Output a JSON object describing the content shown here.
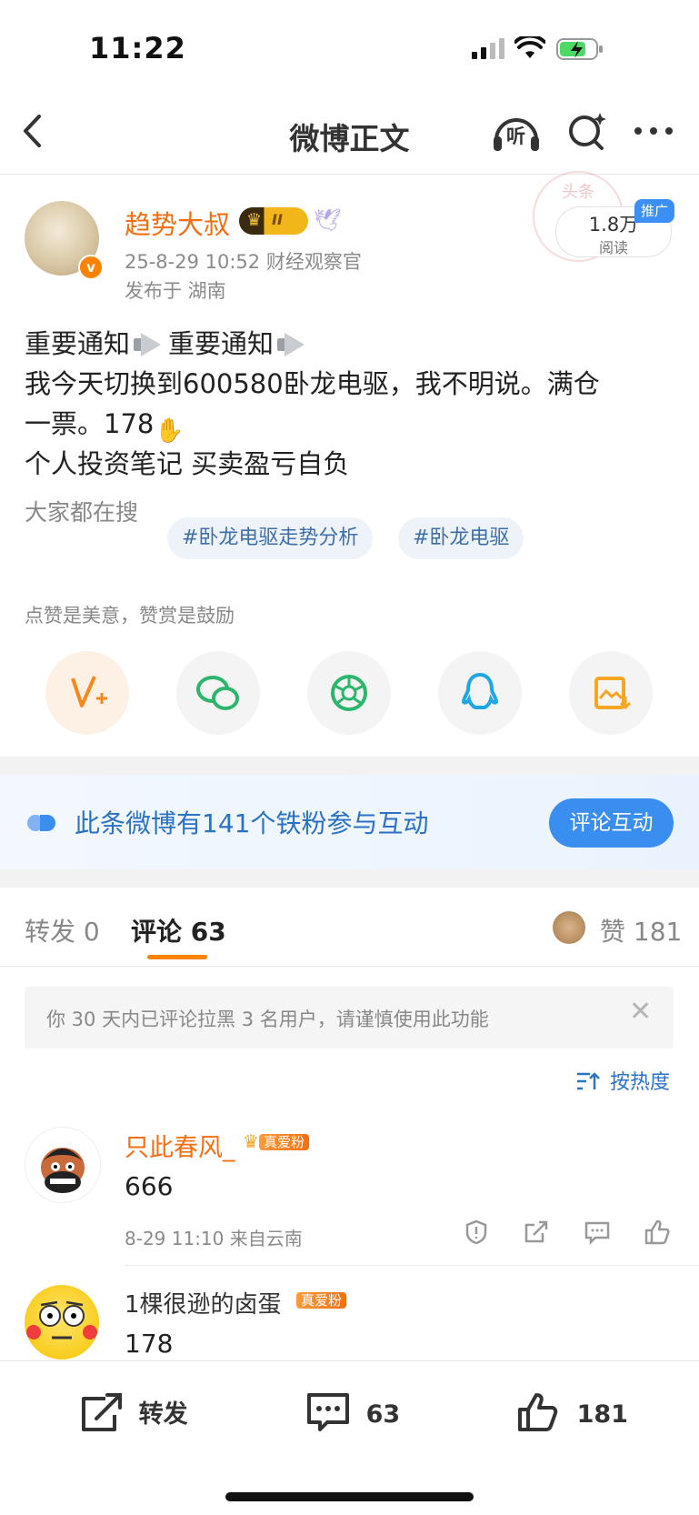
{
  "status_bar": {
    "time": "11:22"
  },
  "nav": {
    "title": "微博正文",
    "listen_label": "听"
  },
  "author": {
    "name": "趋势大叔",
    "level_badge": "II",
    "meta": "25-8-29 10:52  财经观察官",
    "location": "发布于 湖南",
    "read_count": "1.8万",
    "read_label": "阅读",
    "promo_tag": "推广",
    "stamp_text": "头条"
  },
  "post": {
    "line1_a": "重要通知",
    "line1_b": "重要通知",
    "line2": "我今天切换到600580卧龙电驱，我不明说。满仓",
    "line3": "一票。178",
    "line4": " 个人投资笔记 买卖盈亏自负"
  },
  "search": {
    "label": "大家都在搜",
    "chips": [
      "#卧龙电驱走势分析",
      "#卧龙电驱"
    ]
  },
  "reward_tip": "点赞是美意，赞赏是鼓励",
  "share_targets": [
    "reward",
    "wechat",
    "moments",
    "qq",
    "save-image"
  ],
  "banner": {
    "text": "此条微博有141个铁粉参与互动",
    "button": "评论互动"
  },
  "tabs": {
    "repost": "转发 0",
    "comment": "评论 63",
    "like_label": "赞",
    "like_count": "181"
  },
  "notice": {
    "text": "你 30 天内已评论拉黑 3 名用户，请谨慎使用此功能"
  },
  "sort": {
    "label": "按热度"
  },
  "comments": [
    {
      "name": "只此春风_",
      "badge": "真爱粉",
      "text": "666",
      "meta": "8-29 11:10  来自云南"
    },
    {
      "name": "1棵很逊的卤蛋",
      "badge": "真爱粉",
      "text": "178"
    }
  ],
  "bottom_bar": {
    "repost_label": "转发",
    "comment_count": "63",
    "like_count": "181"
  },
  "colors": {
    "accent_orange": "#f56e0f",
    "link_blue": "#2c72c4",
    "button_blue": "#3a8ef0"
  }
}
